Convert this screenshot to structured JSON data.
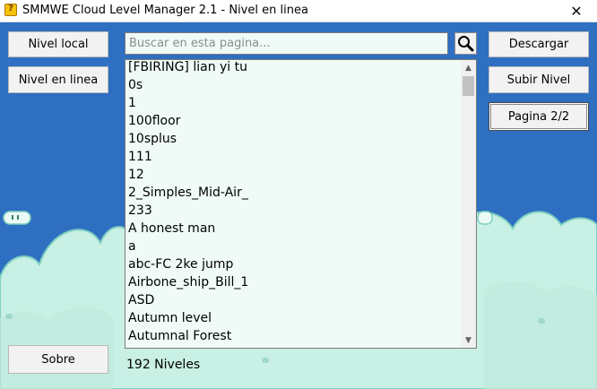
{
  "window": {
    "title": "SMMWE Cloud Level Manager 2.1 - Nivel en linea",
    "close_glyph": "✕"
  },
  "left_buttons": {
    "local": "Nivel local",
    "online": "Nivel en linea",
    "about": "Sobre"
  },
  "right_buttons": {
    "download": "Descargar",
    "upload": "Subir Nivel",
    "page": "Pagina 2/2"
  },
  "search": {
    "placeholder": "Buscar en esta pagina...",
    "value": "",
    "icon": "magnifier-icon"
  },
  "levels": {
    "items": [
      "[FBIRING] lian yi tu",
      "0s",
      "1",
      "100floor",
      "10splus",
      "111",
      "12",
      "2_Simples_Mid-Air_",
      "233",
      "A honest man",
      "a",
      "abc-FC 2ke jump",
      "Airbone_ship_Bill_1",
      "ASD",
      "Autumn level",
      "Autumnal Forest"
    ],
    "scroll_up_glyph": "▲",
    "scroll_down_glyph": "▼"
  },
  "status": {
    "count": "192 Niveles"
  },
  "colors": {
    "sky": "#2f6fc2",
    "cloud": "#c9f0e4",
    "cloud_outline": "#7fd0c0"
  }
}
